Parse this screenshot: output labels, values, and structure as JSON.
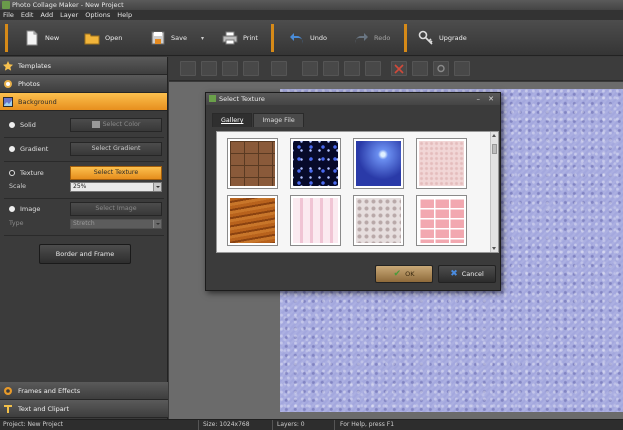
{
  "window": {
    "title": "Photo Collage Maker - New Project"
  },
  "menu": [
    "File",
    "Edit",
    "Add",
    "Layer",
    "Options",
    "Help"
  ],
  "toolbar": {
    "new": "New",
    "open": "Open",
    "save": "Save",
    "print": "Print",
    "undo": "Undo",
    "redo": "Redo",
    "upgrade": "Upgrade"
  },
  "sidebar": {
    "templates": "Templates",
    "photos": "Photos",
    "background": "Background",
    "solid_label": "Solid",
    "select_color": "Select Color",
    "gradient_label": "Gradient",
    "select_gradient": "Select Gradient",
    "texture_label": "Texture",
    "select_texture": "Select Texture",
    "scale_label": "Scale",
    "scale_value": "25%",
    "image_label": "Image",
    "select_image": "Select Image",
    "type_label": "Type",
    "type_value": "Stretch",
    "border_frame": "Border and Frame",
    "frames_effects": "Frames and Effects",
    "text_clipart": "Text and Clipart"
  },
  "dialog": {
    "title": "Select Texture",
    "tab_gallery": "Gallery",
    "tab_image_file": "Image File",
    "ok": "OK",
    "cancel": "Cancel",
    "textures": [
      "brick",
      "blue-stars",
      "blue-star-burst",
      "pink-marble",
      "wood",
      "pink-stripes",
      "lace",
      "pink-brick"
    ]
  },
  "status": {
    "project": "Project: New Project",
    "size": "Size: 1024x768",
    "layers": "Layers: 0",
    "help": "For Help, press F1"
  },
  "colors": {
    "accent": "#f0a030",
    "canvas": "#a4a8de",
    "panel": "#3b3b3b"
  }
}
